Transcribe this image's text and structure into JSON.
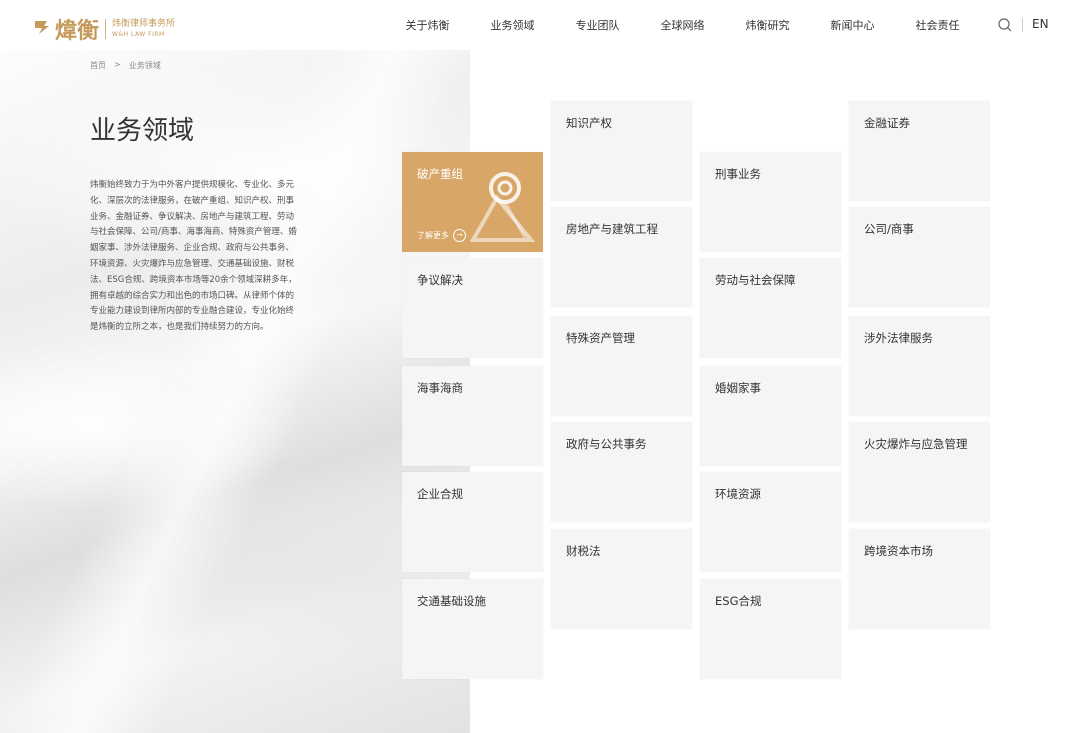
{
  "header": {
    "logo": {
      "cn_name": "炜衡律师事务所",
      "en_name": "W&H LAW FIRM",
      "mark": "煒衡"
    },
    "nav": [
      "关于炜衡",
      "业务领域",
      "专业团队",
      "全球网络",
      "炜衡研究",
      "新闻中心",
      "社会责任"
    ],
    "search_icon": "search-icon",
    "lang": "EN"
  },
  "breadcrumb": {
    "home": "首页",
    "sep": ">",
    "current": "业务领域"
  },
  "page_title": "业务领域",
  "intro": "炜衡始终致力于为中外客户提供规模化、专业化、多元化、深层次的法律服务，在破产重组、知识产权、刑事业务、金融证券、争议解决、房地产与建筑工程、劳动与社会保障、公司/商事、海事海商、特殊资产管理、婚姻家事、涉外法律服务、企业合规、政府与公共事务、环境资源、火灾爆炸与应急管理、交通基础设施、财税法、ESG合规、跨境资本市场等20余个领域深耕多年，拥有卓越的综合实力和出色的市场口碑。从律师个体的专业能力建设到律所内部的专业融合建设，专业化始终是炜衡的立所之本，也是我们持续努力的方向。",
  "colors": {
    "accent": "#d8a768",
    "brand": "#c59a5a",
    "tile_bg": "#f5f5f5"
  },
  "practice_areas": {
    "col1": [
      "破产重组",
      "争议解决",
      "海事海商",
      "企业合规",
      "交通基础设施"
    ],
    "col2": [
      "知识产权",
      "房地产与建筑工程",
      "特殊资产管理",
      "政府与公共事务",
      "财税法"
    ],
    "col3": [
      "刑事业务",
      "劳动与社会保障",
      "婚姻家事",
      "环境资源",
      "ESG合规"
    ],
    "col4": [
      "金融证券",
      "公司/商事",
      "涉外法律服务",
      "火灾爆炸与应急管理",
      "跨境资本市场"
    ],
    "learn_more": "了解更多",
    "active": "破产重组"
  }
}
